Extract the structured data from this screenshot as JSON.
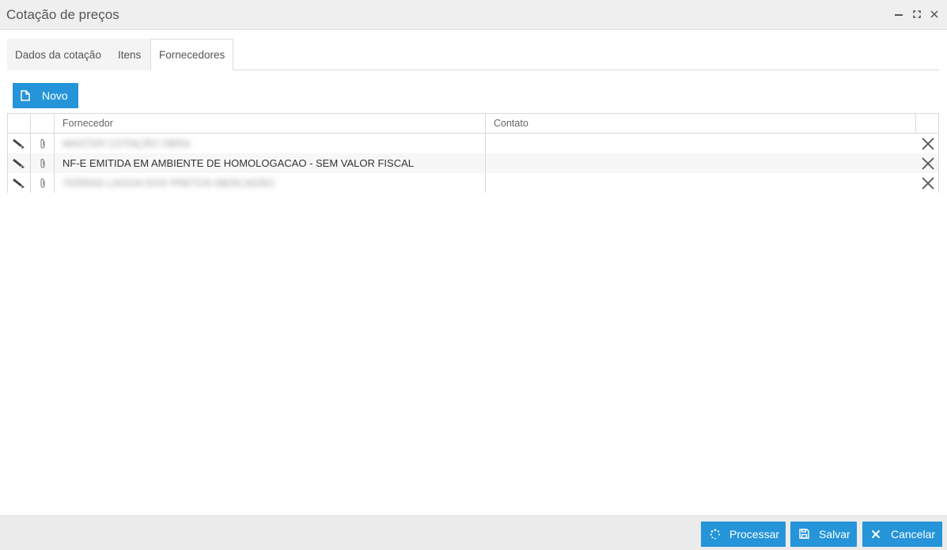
{
  "window": {
    "title": "Cotação de preços",
    "controls": {
      "minimize": "minimize-icon",
      "maximize": "maximize-icon",
      "close": "close-icon"
    }
  },
  "tabs": [
    {
      "label": "Dados da cotação",
      "active": false
    },
    {
      "label": "Itens",
      "active": false
    },
    {
      "label": "Fornecedores",
      "active": true
    }
  ],
  "toolbar": {
    "new_label": "Novo",
    "new_icon": "file-icon"
  },
  "grid": {
    "columns": [
      "Fornecedor",
      "Contato"
    ],
    "rows": [
      {
        "fornecedor": "MASTER COTAÇÃO OBRA",
        "contato": "",
        "blurred": true
      },
      {
        "fornecedor": "NF-E EMITIDA EM AMBIENTE DE HOMOLOGACAO - SEM VALOR FISCAL",
        "contato": "",
        "blurred": false
      },
      {
        "fornecedor": "TERRAS LAGOA DOS PRETOS MERCADÃO",
        "contato": "",
        "blurred": true
      }
    ],
    "row_icons": {
      "edit": "pencil-icon",
      "attach": "paperclip-icon",
      "delete": "x-icon"
    }
  },
  "footer": {
    "process_label": "Processar",
    "save_label": "Salvar",
    "cancel_label": "Cancelar"
  },
  "colors": {
    "accent": "#2594d9",
    "titlebar": "#efefef",
    "footer": "#ececec"
  }
}
